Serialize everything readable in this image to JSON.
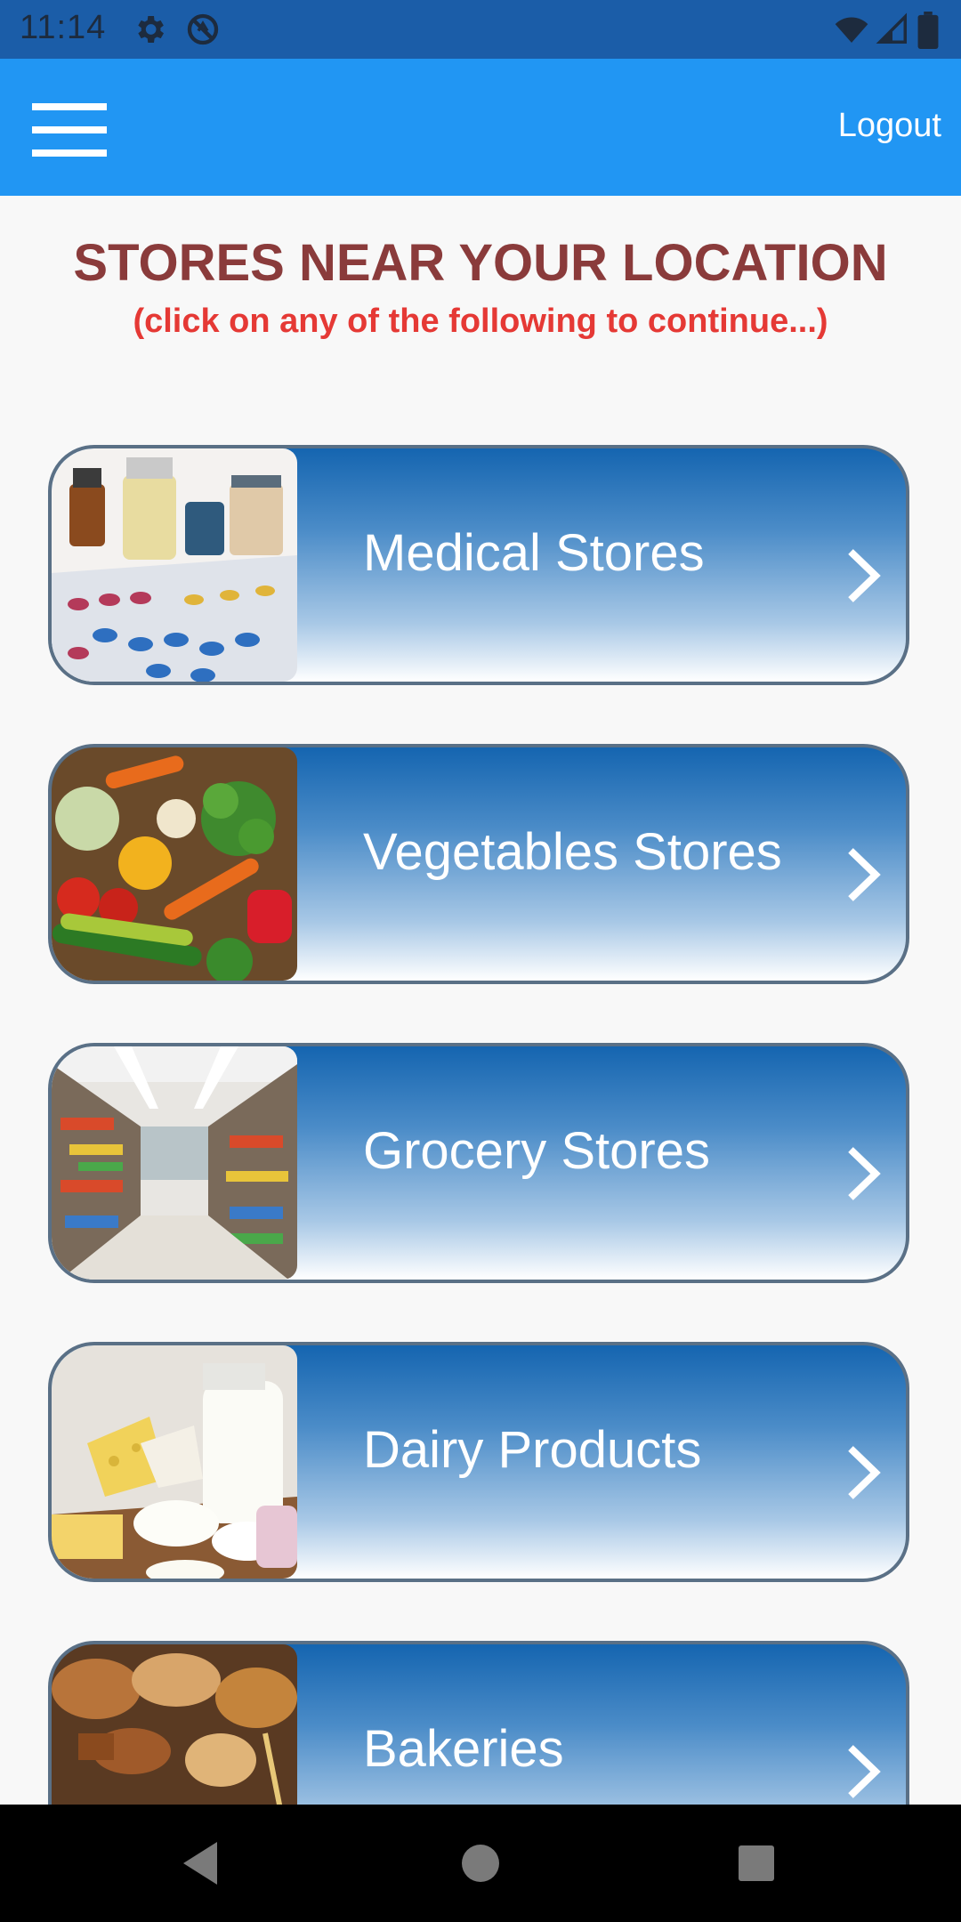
{
  "status_bar": {
    "time": "11:14",
    "icons": [
      "settings-icon",
      "no-sync-icon",
      "wifi-icon",
      "signal-icon",
      "battery-icon"
    ]
  },
  "app_bar": {
    "menu_icon": "hamburger-menu-icon",
    "logout_label": "Logout"
  },
  "page": {
    "title": "STORES NEAR YOUR LOCATION",
    "subtitle": "(click on any of the following to continue...)"
  },
  "stores": [
    {
      "label": "Medical Stores",
      "image": "medicine-image"
    },
    {
      "label": "Vegetables Stores",
      "image": "vegetables-image"
    },
    {
      "label": "Grocery Stores",
      "image": "grocery-aisle-image"
    },
    {
      "label": "Dairy Products",
      "image": "dairy-image"
    },
    {
      "label": "Bakeries",
      "image": "bread-image"
    }
  ],
  "nav": {
    "back": "back-icon",
    "home": "home-icon",
    "recents": "recents-icon"
  },
  "colors": {
    "app_bar": "#2196f3",
    "status_bar": "#1b5da8",
    "title": "#8a3b3b",
    "subtitle": "#e53935",
    "card_top": "#1565b0",
    "card_border": "#5a7086"
  }
}
